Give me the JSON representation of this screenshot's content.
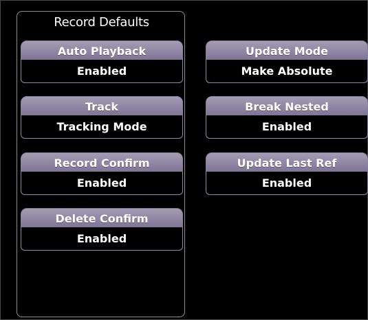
{
  "panel": {
    "title": "Record Defaults"
  },
  "settings_left": [
    {
      "label": "Auto Playback",
      "value": "Enabled"
    },
    {
      "label": "Track",
      "value": "Tracking Mode"
    },
    {
      "label": "Record Confirm",
      "value": "Enabled"
    },
    {
      "label": "Delete Confirm",
      "value": "Enabled"
    }
  ],
  "settings_right": [
    {
      "label": "Update Mode",
      "value": "Make Absolute"
    },
    {
      "label": "Break Nested",
      "value": "Enabled"
    },
    {
      "label": "Update Last Ref",
      "value": "Enabled"
    }
  ],
  "colors": {
    "background": "#000000",
    "label_fill": "#938aa6",
    "text": "#ffffff",
    "panel_border": "#8e8e8e"
  }
}
